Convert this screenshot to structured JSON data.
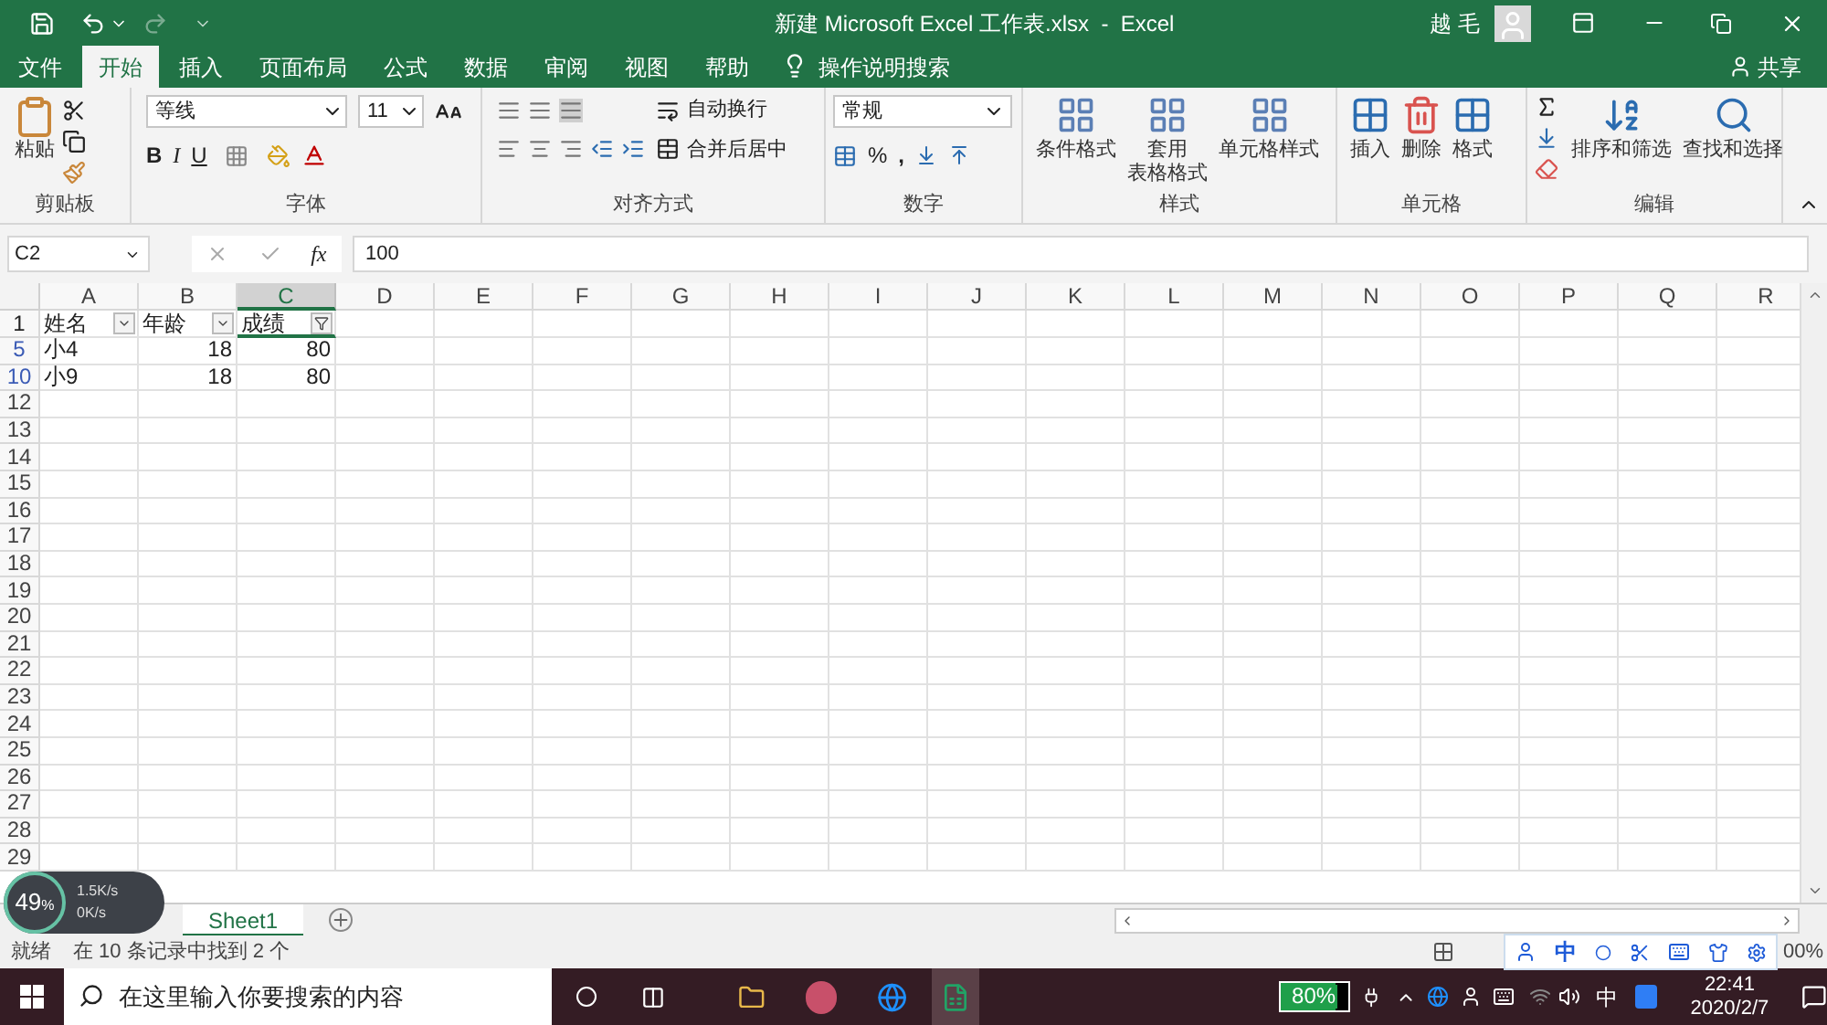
{
  "title_bar": {
    "title": "新建 Microsoft Excel 工作表.xlsx  -  Excel",
    "user": "越 毛"
  },
  "menu_tabs": [
    {
      "label": "文件",
      "selected": false
    },
    {
      "label": "开始",
      "selected": true
    },
    {
      "label": "插入",
      "selected": false
    },
    {
      "label": "页面布局",
      "selected": false
    },
    {
      "label": "公式",
      "selected": false
    },
    {
      "label": "数据",
      "selected": false
    },
    {
      "label": "审阅",
      "selected": false
    },
    {
      "label": "视图",
      "selected": false
    },
    {
      "label": "帮助",
      "selected": false
    }
  ],
  "tell_me": "操作说明搜索",
  "share": "共享",
  "ribbon": {
    "clipboard": {
      "label": "剪贴板",
      "paste": "粘贴"
    },
    "font": {
      "label": "字体",
      "font_name": "等线",
      "font_size": "11",
      "styles": [
        "B",
        "I",
        "U"
      ]
    },
    "alignment": {
      "label": "对齐方式",
      "wrap": "自动换行",
      "merge": "合并后居中"
    },
    "number": {
      "label": "数字",
      "format": "常规",
      "percent": "%",
      "comma": ","
    },
    "styles": {
      "label": "样式",
      "buttons": [
        {
          "lines": [
            "条件格式"
          ]
        },
        {
          "lines": [
            "套用",
            "表格格式"
          ]
        },
        {
          "lines": [
            "单元格样式"
          ]
        }
      ]
    },
    "cells": {
      "label": "单元格",
      "buttons": [
        "插入",
        "删除",
        "格式"
      ]
    },
    "editing": {
      "label": "编辑",
      "buttons": [
        "排序和筛选",
        "查找和选择"
      ]
    }
  },
  "formula_bar": {
    "name_box": "C2",
    "fx": "fx",
    "formula": "100"
  },
  "sheet": {
    "columns": [
      {
        "label": "A",
        "selected": false
      },
      {
        "label": "B",
        "selected": false
      },
      {
        "label": "C",
        "selected": true
      },
      {
        "label": "D",
        "selected": false
      },
      {
        "label": "E",
        "selected": false
      },
      {
        "label": "F",
        "selected": false
      },
      {
        "label": "G",
        "selected": false
      },
      {
        "label": "H",
        "selected": false
      },
      {
        "label": "I",
        "selected": false
      },
      {
        "label": "J",
        "selected": false
      },
      {
        "label": "K",
        "selected": false
      },
      {
        "label": "L",
        "selected": false
      },
      {
        "label": "M",
        "selected": false
      },
      {
        "label": "N",
        "selected": false
      },
      {
        "label": "O",
        "selected": false
      },
      {
        "label": "P",
        "selected": false
      },
      {
        "label": "Q",
        "selected": false
      },
      {
        "label": "R",
        "selected": false
      }
    ],
    "header_row": {
      "number": "1",
      "cells": [
        {
          "text": "姓名",
          "filtered": false
        },
        {
          "text": "年龄",
          "filtered": false
        },
        {
          "text": "成绩",
          "filtered": true
        }
      ]
    },
    "rows": [
      {
        "number": "5",
        "filtered": true,
        "cells": [
          "小4",
          "18",
          "80"
        ]
      },
      {
        "number": "10",
        "filtered": true,
        "cells": [
          "小9",
          "18",
          "80"
        ]
      },
      {
        "number": "12",
        "filtered": false,
        "cells": []
      },
      {
        "number": "13",
        "filtered": false,
        "cells": []
      },
      {
        "number": "14",
        "filtered": false,
        "cells": []
      },
      {
        "number": "15",
        "filtered": false,
        "cells": []
      },
      {
        "number": "16",
        "filtered": false,
        "cells": []
      },
      {
        "number": "17",
        "filtered": false,
        "cells": []
      },
      {
        "number": "18",
        "filtered": false,
        "cells": []
      },
      {
        "number": "19",
        "filtered": false,
        "cells": []
      },
      {
        "number": "20",
        "filtered": false,
        "cells": []
      },
      {
        "number": "21",
        "filtered": false,
        "cells": []
      },
      {
        "number": "22",
        "filtered": false,
        "cells": []
      },
      {
        "number": "23",
        "filtered": false,
        "cells": []
      },
      {
        "number": "24",
        "filtered": false,
        "cells": []
      },
      {
        "number": "25",
        "filtered": false,
        "cells": []
      },
      {
        "number": "26",
        "filtered": false,
        "cells": []
      },
      {
        "number": "27",
        "filtered": false,
        "cells": []
      },
      {
        "number": "28",
        "filtered": false,
        "cells": []
      },
      {
        "number": "29",
        "filtered": false,
        "cells": []
      }
    ]
  },
  "sheet_tabs": [
    {
      "label": "Sheet1",
      "selected": true
    }
  ],
  "status_bar": {
    "ready": "就绪",
    "message": "在 10 条记录中找到 2 个",
    "zoom": "00%"
  },
  "net_widget": {
    "percent": "49",
    "unit": "%",
    "up": "1.5K/s",
    "down": "0K/s"
  },
  "ime_bar": {
    "mode": "中"
  },
  "taskbar": {
    "search_placeholder": "在这里输入你要搜索的内容",
    "battery": {
      "text": "80%",
      "level": 0.8
    },
    "ime": "中",
    "time": "22:41",
    "date": "2020/2/7"
  }
}
